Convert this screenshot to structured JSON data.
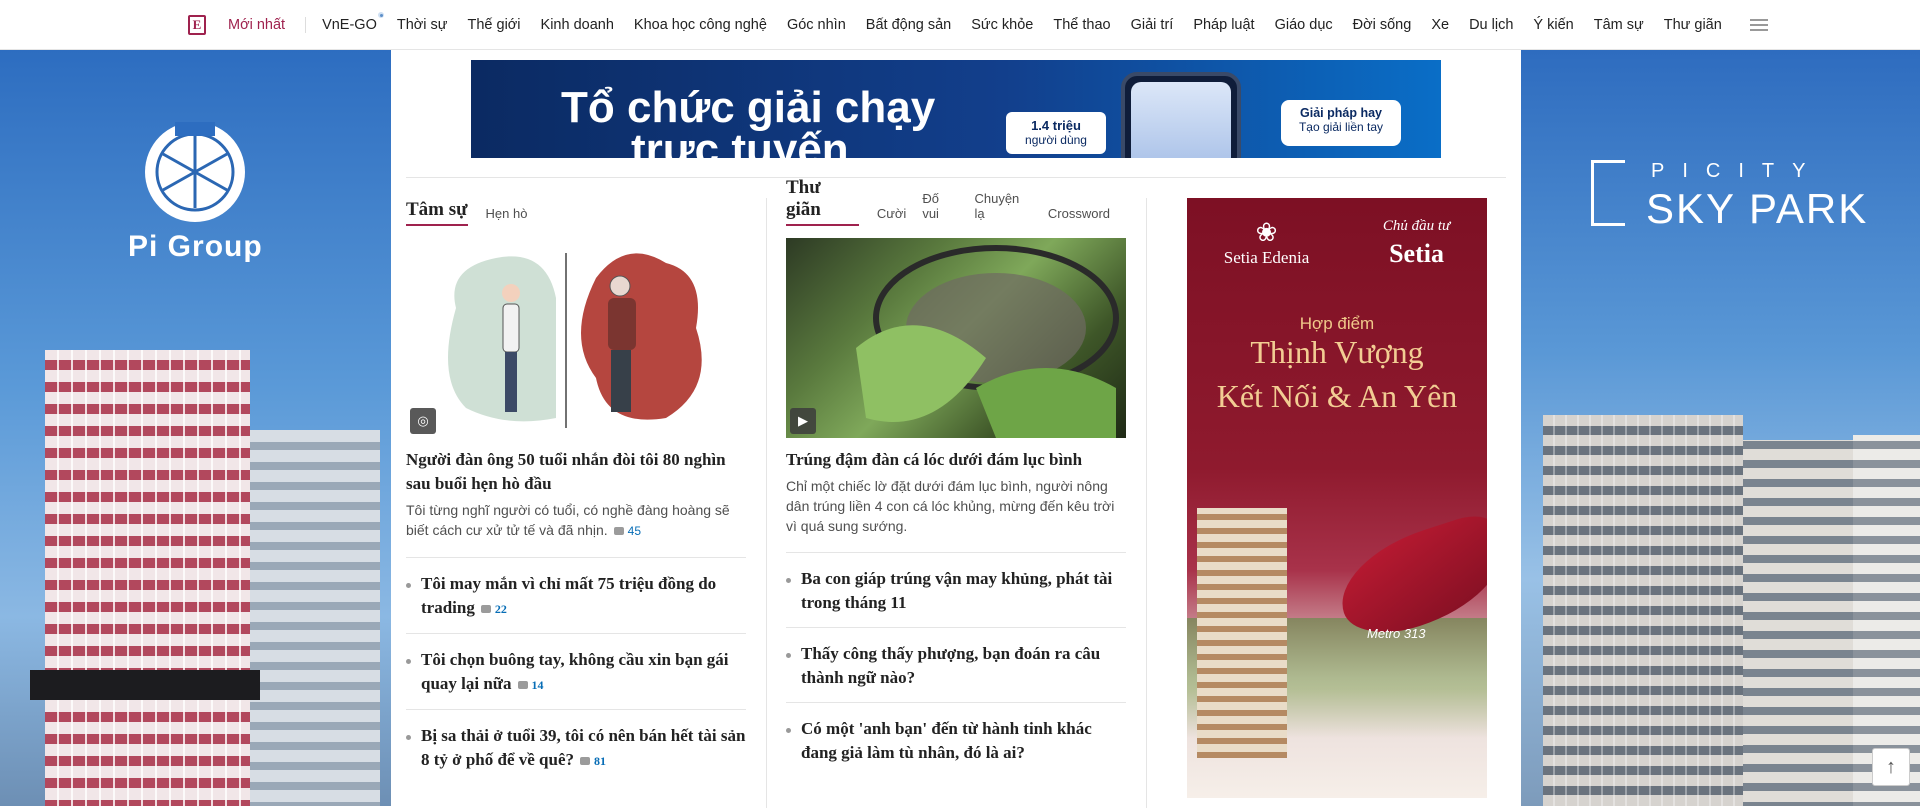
{
  "nav": {
    "logo_letter": "E",
    "items": [
      {
        "label": "Mới nhất"
      },
      {
        "label": "VnE-GO"
      },
      {
        "label": "Thời sự"
      },
      {
        "label": "Thế giới"
      },
      {
        "label": "Kinh doanh"
      },
      {
        "label": "Khoa học công nghệ"
      },
      {
        "label": "Góc nhìn"
      },
      {
        "label": "Bất động sản"
      },
      {
        "label": "Sức khỏe"
      },
      {
        "label": "Thể thao"
      },
      {
        "label": "Giải trí"
      },
      {
        "label": "Pháp luật"
      },
      {
        "label": "Giáo dục"
      },
      {
        "label": "Đời sống"
      },
      {
        "label": "Xe"
      },
      {
        "label": "Du lịch"
      },
      {
        "label": "Ý kiến"
      },
      {
        "label": "Tâm sự"
      },
      {
        "label": "Thư giãn"
      }
    ]
  },
  "skins": {
    "left_brand": "Pi Group",
    "right_brand_small": "PICITY",
    "right_brand_big": "SKY PARK"
  },
  "banner": {
    "line1": "Tổ chức giải chạy",
    "line2": "trực tuyến",
    "badge_value": "1.4 triệu",
    "badge_label": "người dùng",
    "pill_title": "Giải pháp hay",
    "pill_text": "Tạo giải liền tay"
  },
  "tamsu": {
    "title": "Tâm sự",
    "subs": [
      "Hẹn hò"
    ],
    "lead": {
      "title": "Người đàn ông 50 tuổi nhắn đòi tôi 80 nghìn sau buổi hẹn hò đầu",
      "desc": "Tôi từng nghĩ người có tuổi, có nghề đàng hoàng sẽ biết cách cư xử tử tế và đã nhịn.",
      "comments": "45"
    },
    "items": [
      {
        "title": "Tôi may mắn vì chỉ mất 75 triệu đồng do trading",
        "comments": "22"
      },
      {
        "title": "Tôi chọn buông tay, không cầu xin bạn gái quay lại nữa",
        "comments": "14"
      },
      {
        "title": "Bị sa thải ở tuổi 39, tôi có nên bán hết tài sản 8 tỷ ở phố để về quê?",
        "comments": "81"
      }
    ]
  },
  "thugian": {
    "title": "Thư giãn",
    "subs": [
      "Cười",
      "Đố vui",
      "Chuyện lạ",
      "Crossword"
    ],
    "lead": {
      "title": "Trúng đậm đàn cá lóc dưới đám lục bình",
      "desc": "Chỉ một chiếc lờ đặt dưới đám lục bình, người nông dân trúng liền 4 con cá lóc khủng, mừng đến kêu trời vì quá sung sướng."
    },
    "items": [
      {
        "title": "Ba con giáp trúng vận may khủng, phát tài trong tháng 11"
      },
      {
        "title": "Thấy công thấy phượng, bạn đoán ra câu thành ngữ nào?"
      },
      {
        "title": "Có một 'anh bạn' đến từ hành tinh khác đang giả làm tù nhân, đó là ai?"
      }
    ]
  },
  "ad_setia": {
    "brand_left": "Setia Edenia",
    "brand_right_label": "Chủ đầu tư",
    "brand_right_name": "Setia",
    "tagline_small": "Hợp điểm",
    "tagline_line1": "Thịnh Vượng",
    "tagline_line2": "Kết Nối & An Yên",
    "metro_label": "Metro 313"
  },
  "icons": {
    "to_top": "arrow-up-icon",
    "hamburger": "menu-icon",
    "comment": "comment-icon"
  }
}
